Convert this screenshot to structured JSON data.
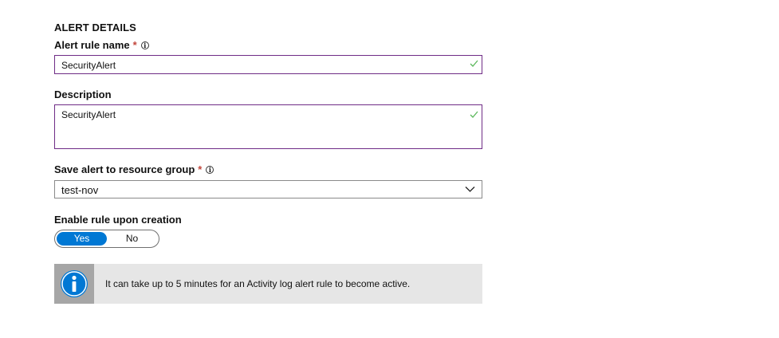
{
  "section": {
    "title": "ALERT DETAILS"
  },
  "alert_rule_name": {
    "label": "Alert rule name",
    "required_mark": "*",
    "value": "SecurityAlert",
    "info_icon": "info-icon",
    "valid_icon": "checkmark-icon"
  },
  "description": {
    "label": "Description",
    "value": "SecurityAlert",
    "valid_icon": "checkmark-icon"
  },
  "resource_group": {
    "label": "Save alert to resource group",
    "required_mark": "*",
    "selected": "test-nov",
    "info_icon": "info-icon",
    "dropdown_icon": "chevron-down-icon"
  },
  "enable_rule": {
    "label": "Enable rule upon creation",
    "options": [
      "Yes",
      "No"
    ],
    "selected": "Yes"
  },
  "notice": {
    "icon": "info-circle-icon",
    "text": "It can take up to 5 minutes for an Activity log alert rule to become active."
  },
  "colors": {
    "accent_blue": "#0078d4",
    "input_border_valid": "#6f2c86",
    "check_green": "#5cb85c",
    "required_red": "#c2463c",
    "notice_bg": "#e6e6e6",
    "notice_strip": "#a6a6a6"
  }
}
